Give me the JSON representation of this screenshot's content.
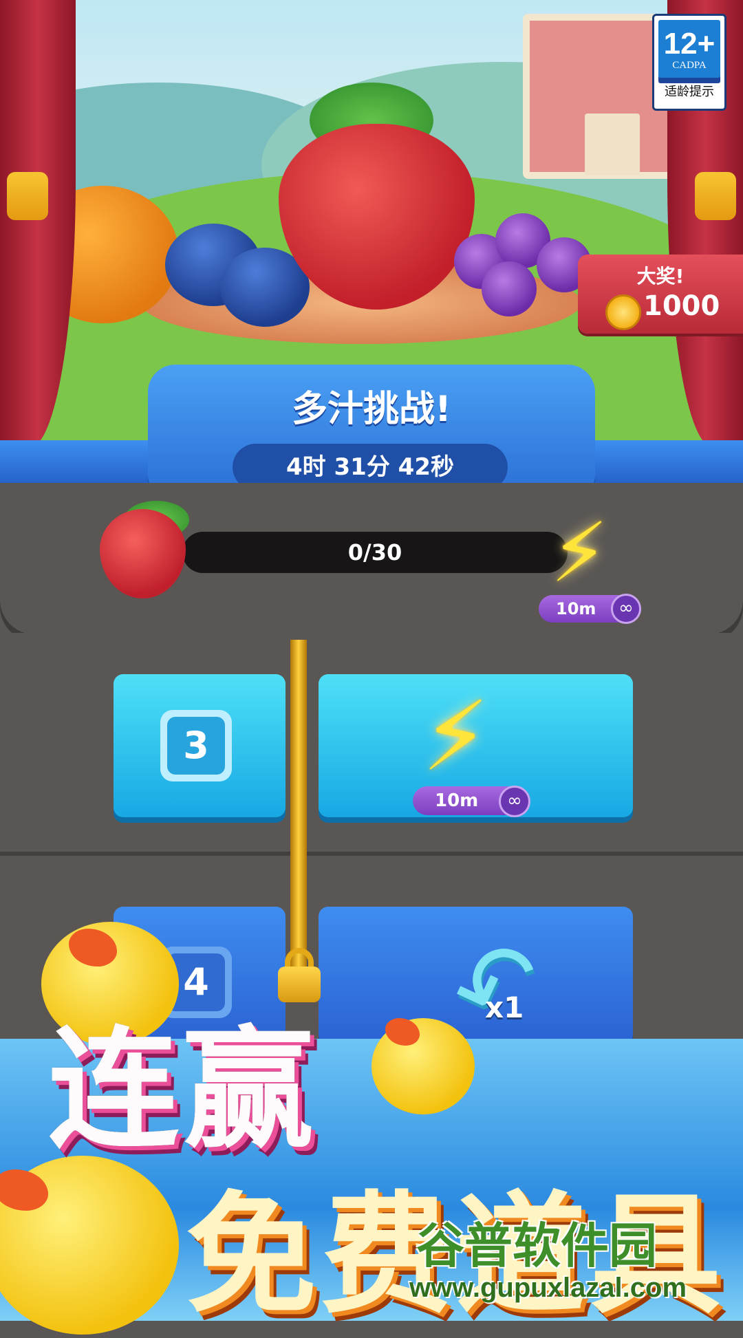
{
  "age_rating": {
    "label": "12+",
    "org": "CADPA",
    "hint": "适龄提示"
  },
  "prize": {
    "title": "大奖!",
    "amount": "1000",
    "icon": "coin-icon"
  },
  "challenge": {
    "title": "多汁挑战!",
    "timer": "4时 31分 42秒"
  },
  "progress": {
    "text": "0/30",
    "current": 0,
    "target": 30,
    "item_icon": "strawberry-icon",
    "reward_icon": "lightning-icon",
    "reward_duration": "10m",
    "reward_symbol": "∞"
  },
  "board": {
    "tiles": [
      {
        "level": "3",
        "reward_icon": "lightning-icon",
        "reward_duration": "10m",
        "reward_symbol": "∞"
      },
      {
        "level": "4",
        "reward_icon": "undo-arrow-icon",
        "reward_count": "x1"
      }
    ]
  },
  "promo": {
    "line1": "连赢",
    "line2": "免费道具"
  },
  "watermark": {
    "line1": "谷普软件园",
    "line2": "www.gupuxlazal.com"
  },
  "colors": {
    "panel_blue": "#3e8ff0",
    "tile_cyan": "#17a8e4",
    "board_gray": "#5a5654",
    "prize_red": "#c92f3c"
  }
}
